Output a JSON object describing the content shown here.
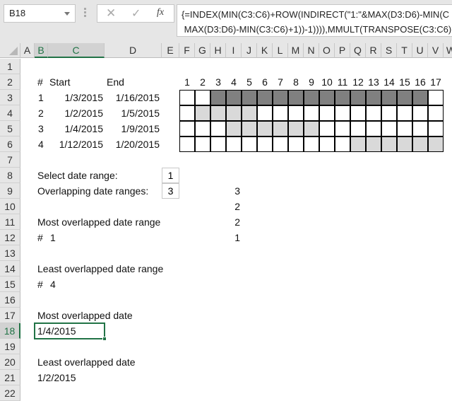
{
  "name_box": {
    "value": "B18"
  },
  "formula_bar": {
    "cancel_icon": "x-icon",
    "enter_icon": "checkmark-icon",
    "fx_label": "fx",
    "formula_line1": "{=INDEX(MIN(C3:C6)+ROW(INDIRECT(\"1:\"&MAX(D3:D6)-MIN(C",
    "formula_line2": " MAX(D3:D6)-MIN(C3:C6)+1))-1)))),MMULT(TRANSPOSE(C3:C6)"
  },
  "columns": [
    "A",
    "B",
    "C",
    "D",
    "E",
    "F",
    "G",
    "H",
    "I",
    "J",
    "K",
    "L",
    "M",
    "N",
    "O",
    "P",
    "Q",
    "R",
    "S",
    "T",
    "U",
    "V",
    "W"
  ],
  "selected_column": "B",
  "rows": [
    "1",
    "2",
    "3",
    "4",
    "5",
    "6",
    "7",
    "8",
    "9",
    "10",
    "11",
    "12",
    "13",
    "14",
    "15",
    "16",
    "17",
    "18",
    "19",
    "20",
    "21",
    "22"
  ],
  "selected_row": "18",
  "table": {
    "headers": {
      "num": "#",
      "start": "Start",
      "end": "End"
    },
    "rows": [
      {
        "num": "1",
        "start": "1/3/2015",
        "end": "1/16/2015"
      },
      {
        "num": "2",
        "start": "1/2/2015",
        "end": "1/5/2015"
      },
      {
        "num": "3",
        "start": "1/4/2015",
        "end": "1/9/2015"
      },
      {
        "num": "4",
        "start": "1/12/2015",
        "end": "1/20/2015"
      }
    ]
  },
  "timeline": {
    "day_labels": [
      "1",
      "2",
      "3",
      "4",
      "5",
      "6",
      "7",
      "8",
      "9",
      "10",
      "11",
      "12",
      "13",
      "14",
      "15",
      "16",
      "17"
    ],
    "rows": [
      {
        "fill": "dark",
        "from": 3,
        "to": 16
      },
      {
        "fill": "light",
        "from": 2,
        "to": 5
      },
      {
        "fill": "light",
        "from": 4,
        "to": 9
      },
      {
        "fill": "light",
        "from": 12,
        "to": 17
      }
    ],
    "colors": {
      "dark": "#808080",
      "light": "#d9d9d9"
    }
  },
  "controls": {
    "select_label": "Select date range:",
    "select_value": "1",
    "overlap_label": "Overlapping date ranges:",
    "overlap_value": "3"
  },
  "overlap_counts": [
    "3",
    "2",
    "2",
    "1"
  ],
  "results": {
    "most_range_label": "Most overlapped date range",
    "most_range_hash": "#",
    "most_range_value": "1",
    "least_range_label": "Least overlapped date range",
    "least_range_hash": "#",
    "least_range_value": "4",
    "most_date_label": "Most overlapped date",
    "most_date_value": "1/4/2015",
    "least_date_label": "Least overlapped date",
    "least_date_value": "1/2/2015"
  }
}
